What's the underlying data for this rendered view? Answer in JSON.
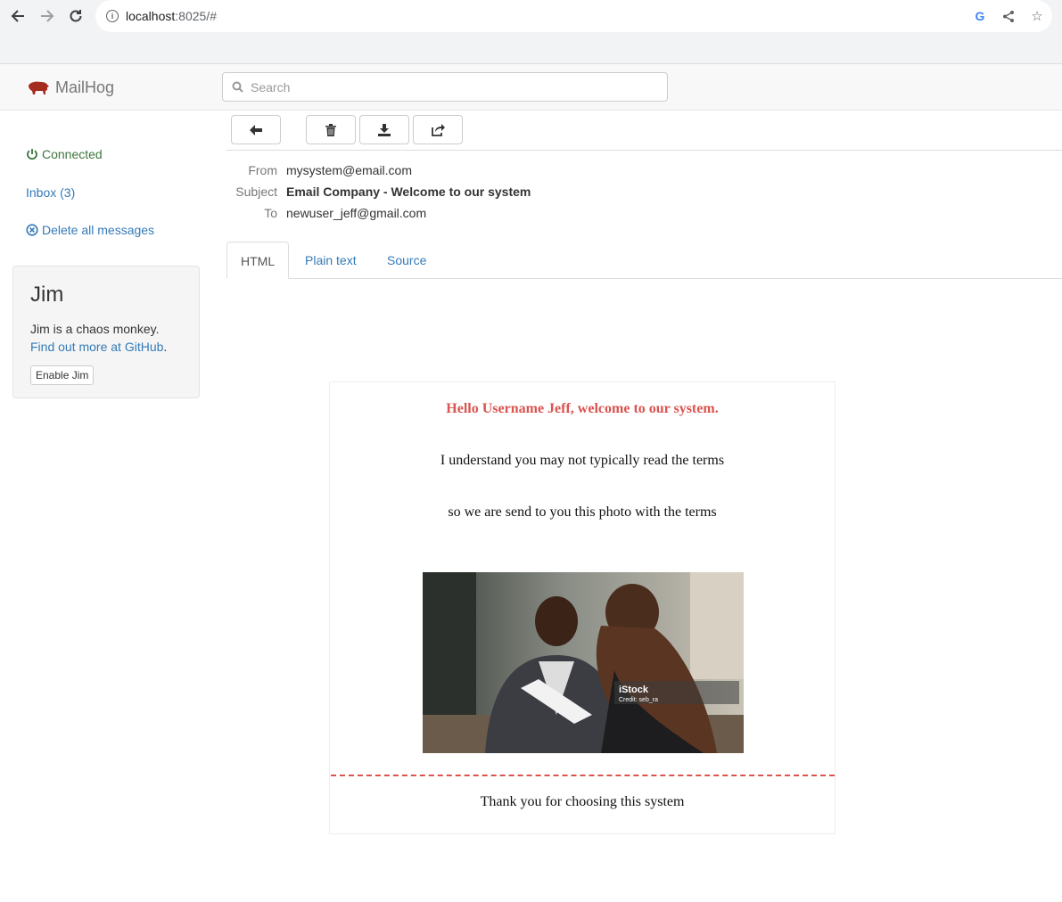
{
  "browser": {
    "url_host": "localhost",
    "url_rest": ":8025/#",
    "icons": [
      "back-icon",
      "forward-icon",
      "reload-icon",
      "info-icon",
      "google-icon",
      "share-icon",
      "star-icon"
    ]
  },
  "app": {
    "brand": "MailHog",
    "search_placeholder": "Search"
  },
  "sidebar": {
    "connected": "Connected",
    "inbox": "Inbox (3)",
    "delete_all": "Delete all messages",
    "jim": {
      "title": "Jim",
      "description": "Jim is a chaos monkey.",
      "link": "Find out more at GitHub",
      "link_suffix": ".",
      "button": "Enable Jim"
    }
  },
  "toolbar": {
    "icons": [
      "back-arrow-icon",
      "trash-icon",
      "download-icon",
      "release-icon"
    ]
  },
  "message": {
    "from_label": "From",
    "from": "mysystem@email.com",
    "subject_label": "Subject",
    "subject": "Email Company - Welcome to our system",
    "to_label": "To",
    "to": "newuser_jeff@gmail.com"
  },
  "tabs": [
    {
      "label": "HTML",
      "active": true
    },
    {
      "label": "Plain text",
      "active": false
    },
    {
      "label": "Source",
      "active": false
    }
  ],
  "email": {
    "greeting": "Hello Username Jeff, welcome to our system.",
    "line1": "I understand you may not typically read the terms",
    "line2": "so we are send to you this photo with the terms",
    "photo_watermark": "iStock",
    "photo_credit": "Credit: seb_ra",
    "thanks": "Thank you for choosing this system"
  },
  "colors": {
    "accent_link": "#337ab7",
    "connected": "#3c763d",
    "greeting": "#d9534f",
    "brand_icon": "#a52a1f"
  }
}
